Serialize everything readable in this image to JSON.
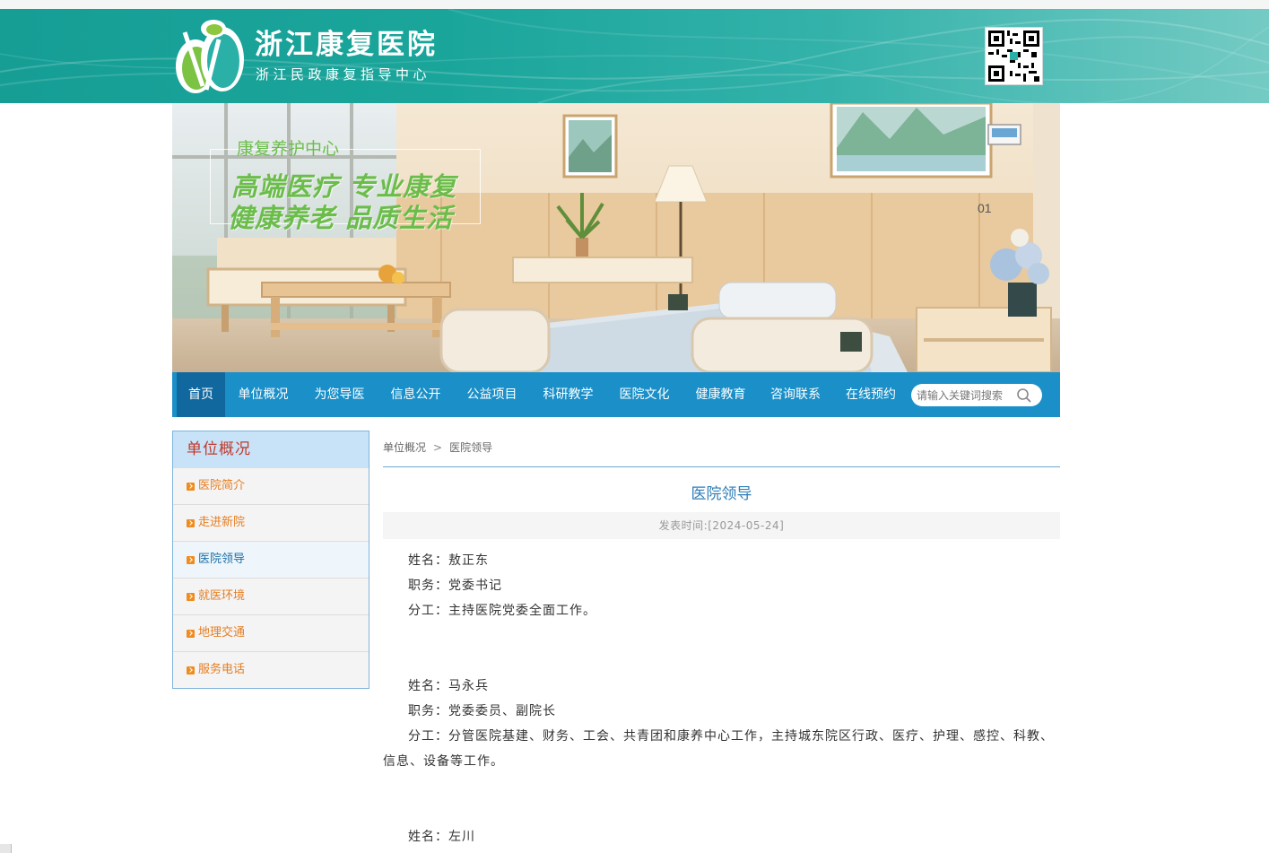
{
  "header": {
    "title": "浙江康复医院",
    "subtitle": "浙江民政康复指导中心",
    "logo_icon": "hospital-logo-icon",
    "qr_icon": "qr-code-icon"
  },
  "hero": {
    "tag": "康复养护中心",
    "line1": "高端医疗 专业康复",
    "line2": "健康养老 品质生活",
    "room_number": "01"
  },
  "nav": {
    "items": [
      {
        "label": "首页"
      },
      {
        "label": "单位概况"
      },
      {
        "label": "为您导医"
      },
      {
        "label": "信息公开"
      },
      {
        "label": "公益项目"
      },
      {
        "label": "科研教学"
      },
      {
        "label": "医院文化"
      },
      {
        "label": "健康教育"
      },
      {
        "label": "咨询联系"
      },
      {
        "label": "在线预约"
      }
    ],
    "active_index": 0,
    "search_placeholder": "请输入关键词搜索"
  },
  "sidebar": {
    "title": "单位概况",
    "items": [
      {
        "label": "医院简介"
      },
      {
        "label": "走进新院"
      },
      {
        "label": "医院领导"
      },
      {
        "label": "就医环境"
      },
      {
        "label": "地理交通"
      },
      {
        "label": "服务电话"
      }
    ],
    "active_index": 2
  },
  "breadcrumb": {
    "items": [
      "单位概况",
      "医院领导"
    ],
    "separator": ">"
  },
  "article": {
    "title": "医院领导",
    "meta": "发表时间:[2024-05-24]",
    "leaders": [
      {
        "name": "姓名：敖正东",
        "role": "职务：党委书记",
        "duty": "分工：主持医院党委全面工作。"
      },
      {
        "name": "姓名：马永兵",
        "role": "职务：党委委员、副院长",
        "duty": "分工：分管医院基建、财务、工会、共青团和康养中心工作，主持城东院区行政、医疗、护理、感控、科教、信息、设备等工作。"
      },
      {
        "name": "姓名：左川"
      }
    ]
  },
  "colors": {
    "header_teal": "#169e95",
    "nav_blue": "#1a8fc8",
    "nav_active": "#11689f",
    "sidebar_head": "#c8e2f7",
    "sidebar_title": "#c0392b",
    "link_orange": "#e67e22",
    "title_blue": "#2e7db8"
  }
}
